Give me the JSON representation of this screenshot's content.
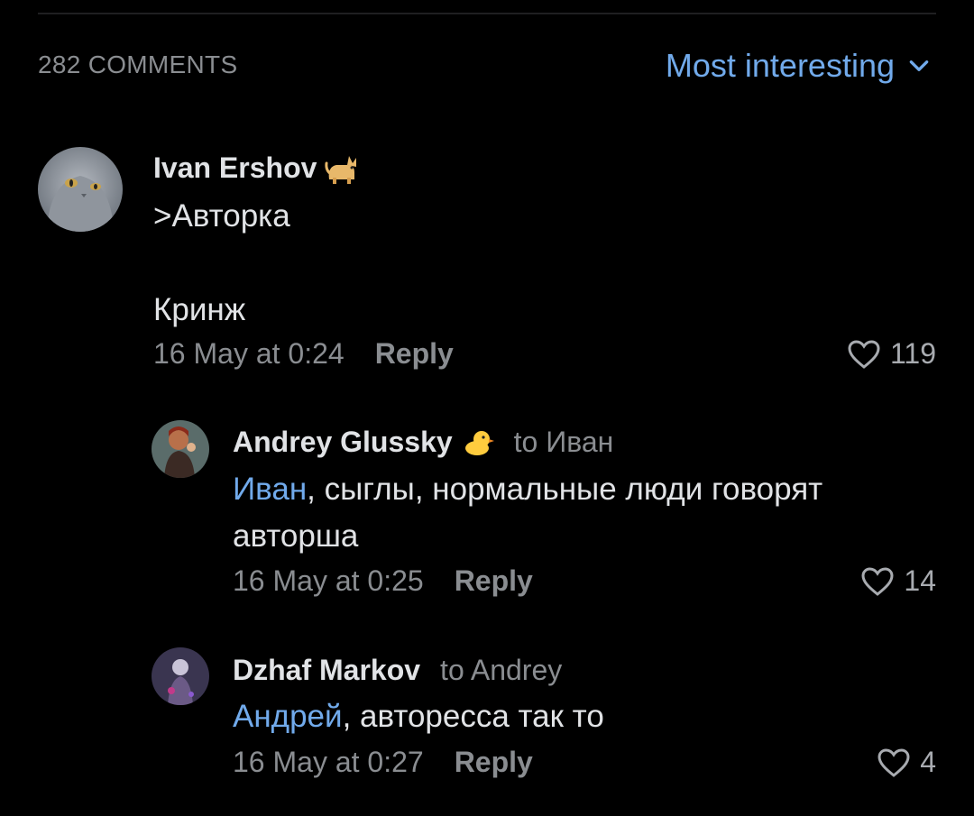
{
  "header": {
    "comments_count": "282 COMMENTS",
    "sort_label": "Most interesting"
  },
  "comments": [
    {
      "author": "Ivan Ershov",
      "badge_icon": "cat-emoji",
      "text": ">Авторка\n\nКринж",
      "date": "16 May at 0:24",
      "reply_label": "Reply",
      "likes": "119"
    },
    {
      "author": "Andrey Glussky",
      "badge_icon": "chick-emoji",
      "to": "to Иван",
      "mention": "Иван",
      "text": ", сыглы, нормальные люди говорят\nавторша",
      "date": "16 May at 0:25",
      "reply_label": "Reply",
      "likes": "14"
    },
    {
      "author": "Dzhaf Markov",
      "to": "to Andrey",
      "mention": "Андрей",
      "text": ", авторесса так то",
      "date": "16 May at 0:27",
      "reply_label": "Reply",
      "likes": "4"
    }
  ],
  "colors": {
    "background": "#000000",
    "accent": "#71aaeb",
    "primary_text": "#e1e3e6",
    "secondary_text": "#8a8d91"
  }
}
